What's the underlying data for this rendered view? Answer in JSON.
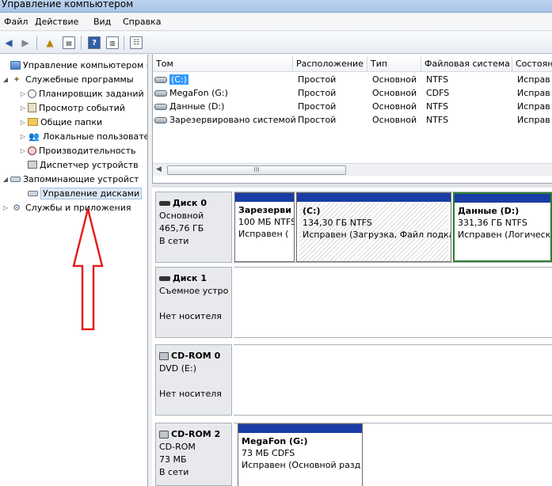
{
  "window": {
    "title": "Управление компьютером"
  },
  "menu": {
    "file": "Файл",
    "action": "Действие",
    "view": "Вид",
    "help": "Справка"
  },
  "toolbar": {
    "back": "back-icon",
    "forward": "forward-icon"
  },
  "tree": {
    "root": "Управление компьютером (л",
    "utilities": "Служебные программы",
    "scheduler": "Планировщик заданий",
    "eventviewer": "Просмотр событий",
    "shared": "Общие папки",
    "localusers": "Локальные пользовате",
    "performance": "Производительность",
    "devmgr": "Диспетчер устройств",
    "storage": "Запоминающие устройст",
    "diskmgmt": "Управление дисками",
    "services": "Службы и приложения"
  },
  "volumes": {
    "headers": [
      "Том",
      "Расположение",
      "Тип",
      "Файловая система",
      "Состоян"
    ],
    "rows": [
      {
        "name": "(C:)",
        "layout": "Простой",
        "type": "Основной",
        "fs": "NTFS",
        "status": "Исправ"
      },
      {
        "name": "MegaFon (G:)",
        "layout": "Простой",
        "type": "Основной",
        "fs": "CDFS",
        "status": "Исправ"
      },
      {
        "name": "Данные (D:)",
        "layout": "Простой",
        "type": "Основной",
        "fs": "NTFS",
        "status": "Исправ"
      },
      {
        "name": "Зарезервировано системой",
        "layout": "Простой",
        "type": "Основной",
        "fs": "NTFS",
        "status": "Исправ"
      }
    ],
    "scroll_grip": "III"
  },
  "disks": {
    "d0": {
      "name": "Диск 0",
      "type": "Основной",
      "size": "465,76 ГБ",
      "status": "В сети",
      "p1": {
        "name": "Зарезерви",
        "info": "100 МБ NTFS",
        "status": "Исправен ("
      },
      "p2": {
        "name": "(C:)",
        "info": "134,30 ГБ NTFS",
        "status": "Исправен (Загрузка, Файл подкач"
      },
      "p3": {
        "name": "Данные  (D:)",
        "info": "331,36 ГБ NTFS",
        "status": "Исправен (Логическ"
      }
    },
    "d1": {
      "name": "Диск 1",
      "type": "Съемное устро",
      "status": "Нет носителя"
    },
    "cd0": {
      "name": "CD-ROM 0",
      "type": "DVD (E:)",
      "status": "Нет носителя"
    },
    "cd2": {
      "name": "CD-ROM 2",
      "type": "CD-ROM",
      "size": "73 МБ",
      "status": "В сети",
      "p1": {
        "name": "MegaFon  (G:)",
        "info": "73 МБ CDFS",
        "status": "Исправен (Основной разд"
      }
    }
  },
  "colors": {
    "partition_bar": "#1a3ca6",
    "selection": "#3399ff",
    "annotation_arrow": "#e02020"
  }
}
